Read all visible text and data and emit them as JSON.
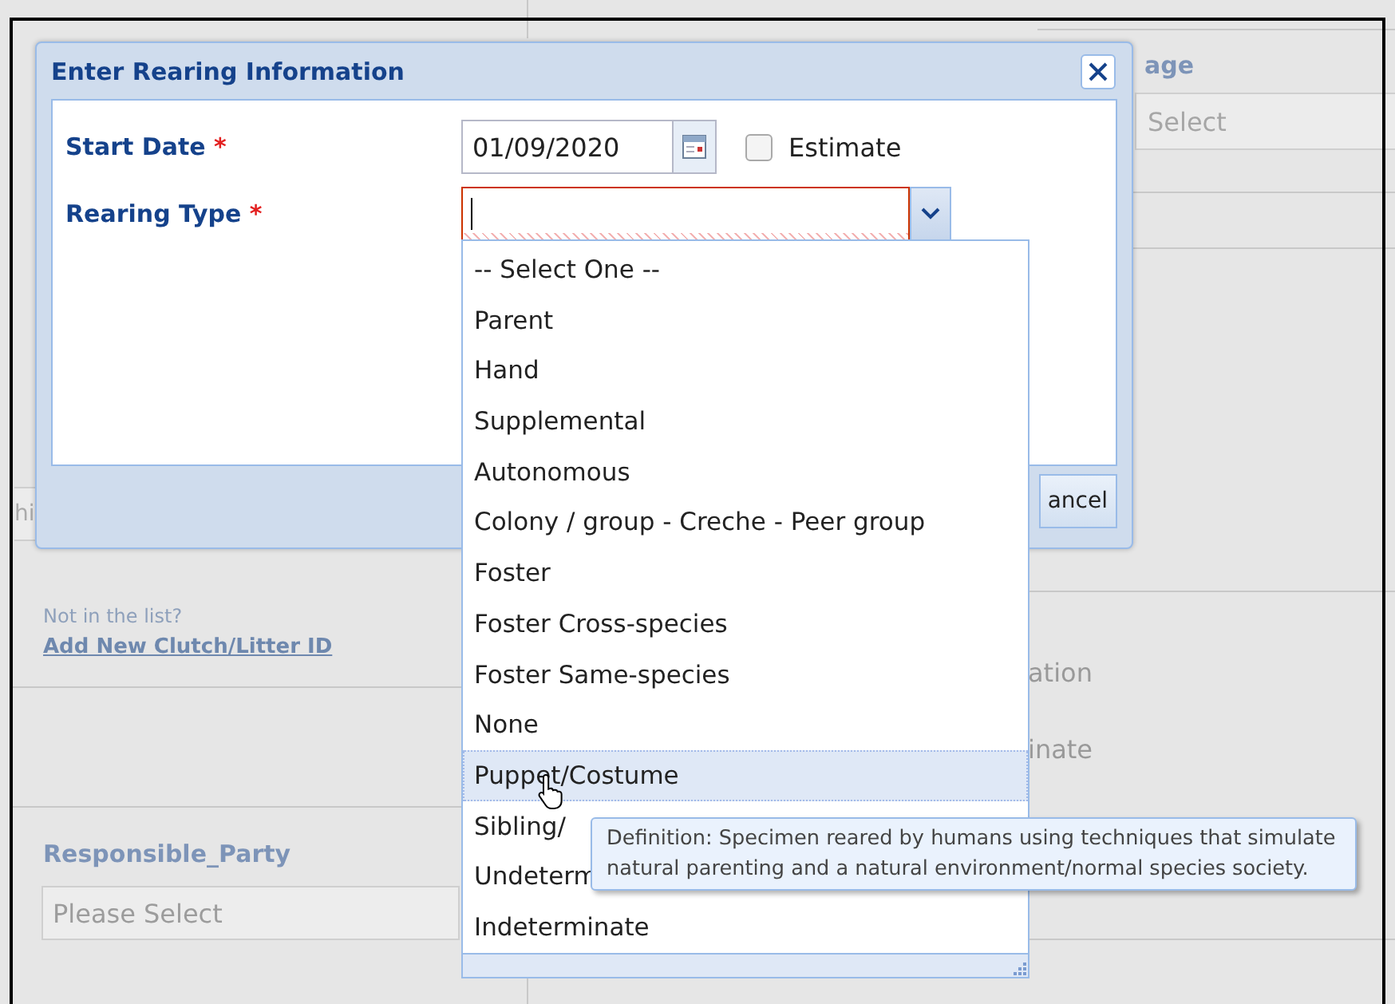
{
  "background": {
    "top_right_label": "age",
    "top_right_placeholder": "Select",
    "left_fragment": "hi",
    "hint": "Not in the list?",
    "link": "Add New Clutch/Litter ID",
    "right_fragments": [
      "ation",
      "inate"
    ],
    "responsible_party": {
      "label": "Responsible_Party",
      "placeholder": "Please Select"
    }
  },
  "dialog": {
    "title": "Enter Rearing Information",
    "fields": [
      {
        "label": "Start Date",
        "required_mark": "*",
        "kind": "date",
        "value": "01/09/2020"
      },
      {
        "label": "Rearing Type",
        "required_mark": "*",
        "kind": "combo",
        "invalid": true
      }
    ],
    "estimate": {
      "label": "Estimate",
      "checked": false
    },
    "buttons": [
      "ancel"
    ]
  },
  "dropdown": {
    "options": [
      {
        "label": "-- Select One --",
        "highlighted": false
      },
      {
        "label": "Parent",
        "highlighted": false
      },
      {
        "label": "Hand",
        "highlighted": false
      },
      {
        "label": "Supplemental",
        "highlighted": false
      },
      {
        "label": "Autonomous",
        "highlighted": false
      },
      {
        "label": "Colony / group - Creche - Peer group",
        "highlighted": false
      },
      {
        "label": "Foster",
        "highlighted": false
      },
      {
        "label": "Foster Cross-species",
        "highlighted": false
      },
      {
        "label": "Foster Same-species",
        "highlighted": false
      },
      {
        "label": "None",
        "highlighted": false
      },
      {
        "label": "Puppet/Costume",
        "highlighted": true
      },
      {
        "label": "Sibling/",
        "highlighted": false
      },
      {
        "label": "Undeterm",
        "highlighted": false
      },
      {
        "label": "Indeterminate",
        "highlighted": false
      }
    ]
  },
  "tooltip": {
    "text": "Definition: Specimen reared by humans using techniques that simulate natural parenting and a natural environment/normal species society."
  }
}
